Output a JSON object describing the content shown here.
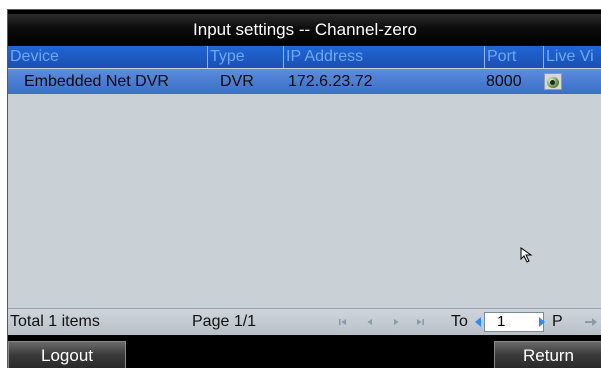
{
  "window": {
    "title": "Input settings -- Channel-zero"
  },
  "table": {
    "columns": [
      "Device",
      "Type",
      "IP Address",
      "Port",
      "Live Vi"
    ],
    "rows": [
      {
        "device": "Embedded Net DVR",
        "type": "DVR",
        "ip": "172.6.23.72",
        "port": "8000",
        "live_icon": "live-view-icon"
      }
    ]
  },
  "footer": {
    "total": "Total 1 items",
    "page": "Page 1/1",
    "to_label": "To",
    "page_input_value": "1",
    "p_label": "P"
  },
  "buttons": {
    "logout": "Logout",
    "return": "Return"
  }
}
